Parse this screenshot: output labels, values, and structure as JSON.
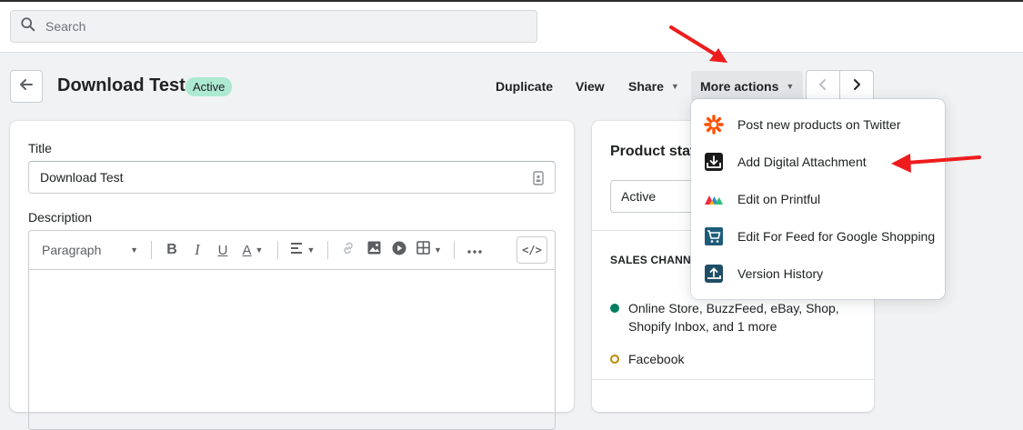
{
  "search": {
    "placeholder": "Search"
  },
  "page": {
    "title": "Download Test",
    "status_badge": "Active"
  },
  "actions": {
    "duplicate": "Duplicate",
    "view": "View",
    "share": "Share",
    "more": "More actions"
  },
  "form": {
    "title_label": "Title",
    "title_value": "Download Test",
    "description_label": "Description",
    "toolbar": {
      "paragraph": "Paragraph",
      "bold": "B",
      "italic": "I",
      "underline": "U",
      "text_color": "A",
      "code": "</>"
    }
  },
  "side": {
    "heading": "Product stat",
    "status_value": "Active",
    "sales_channels_label": "SALES CHANNEL",
    "channels": [
      {
        "label": "Online Store, BuzzFeed, eBay, Shop, Shopify Inbox, and 1 more",
        "color": "#007f5f"
      },
      {
        "label": "Facebook",
        "color": "#b98900"
      }
    ]
  },
  "dropdown": {
    "items": [
      {
        "label": "Post new products on Twitter",
        "icon": "zapier-icon"
      },
      {
        "label": "Add Digital Attachment",
        "icon": "digital-attachment-icon"
      },
      {
        "label": "Edit on Printful",
        "icon": "printful-icon"
      },
      {
        "label": "Edit For Feed for Google Shopping",
        "icon": "google-shopping-feed-icon"
      },
      {
        "label": "Version History",
        "icon": "version-history-icon"
      }
    ]
  },
  "colors": {
    "annotation_arrow": "#ee1c1c",
    "badge_bg": "#aee9d1"
  }
}
